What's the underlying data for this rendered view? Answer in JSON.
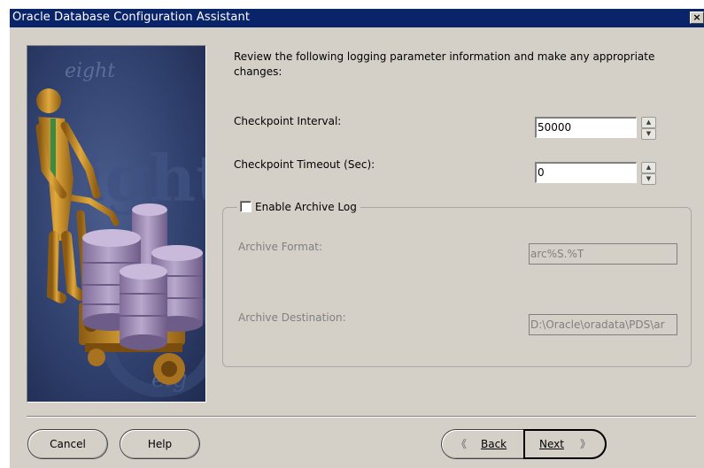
{
  "window": {
    "title": "Oracle Database Configuration Assistant",
    "close_glyph": "×"
  },
  "illustration": {
    "watermark_text": "eight",
    "watermark_text_small": "eig"
  },
  "instructions": "Review the following logging parameter information and make any appropriate changes:",
  "checkpoint_interval": {
    "label": "Checkpoint Interval:",
    "value": "50000"
  },
  "checkpoint_timeout": {
    "label": "Checkpoint Timeout (Sec):",
    "value": "0"
  },
  "archive_group": {
    "checkbox_label": "Enable Archive Log",
    "checked": false,
    "archive_format": {
      "label": "Archive Format:",
      "value": "arc%S.%T"
    },
    "archive_destination": {
      "label": "Archive Destination:",
      "value": "D:\\Oracle\\oradata\\PDS\\ar"
    }
  },
  "buttons": {
    "cancel": "Cancel",
    "help": "Help",
    "back": "Back",
    "next": "Next"
  },
  "icons": {
    "spin_up": "spinner-up-arrow-icon",
    "spin_down": "spinner-down-arrow-icon",
    "back": "double-chevron-left-icon",
    "next": "double-chevron-right-icon",
    "close": "close-icon"
  },
  "colors": {
    "titlebar": "#0a246a",
    "dialog_face": "#d4d0c8",
    "panel_background": "#2c3e6a",
    "figure": "#c8902a",
    "cylinders": "#a491b8"
  }
}
